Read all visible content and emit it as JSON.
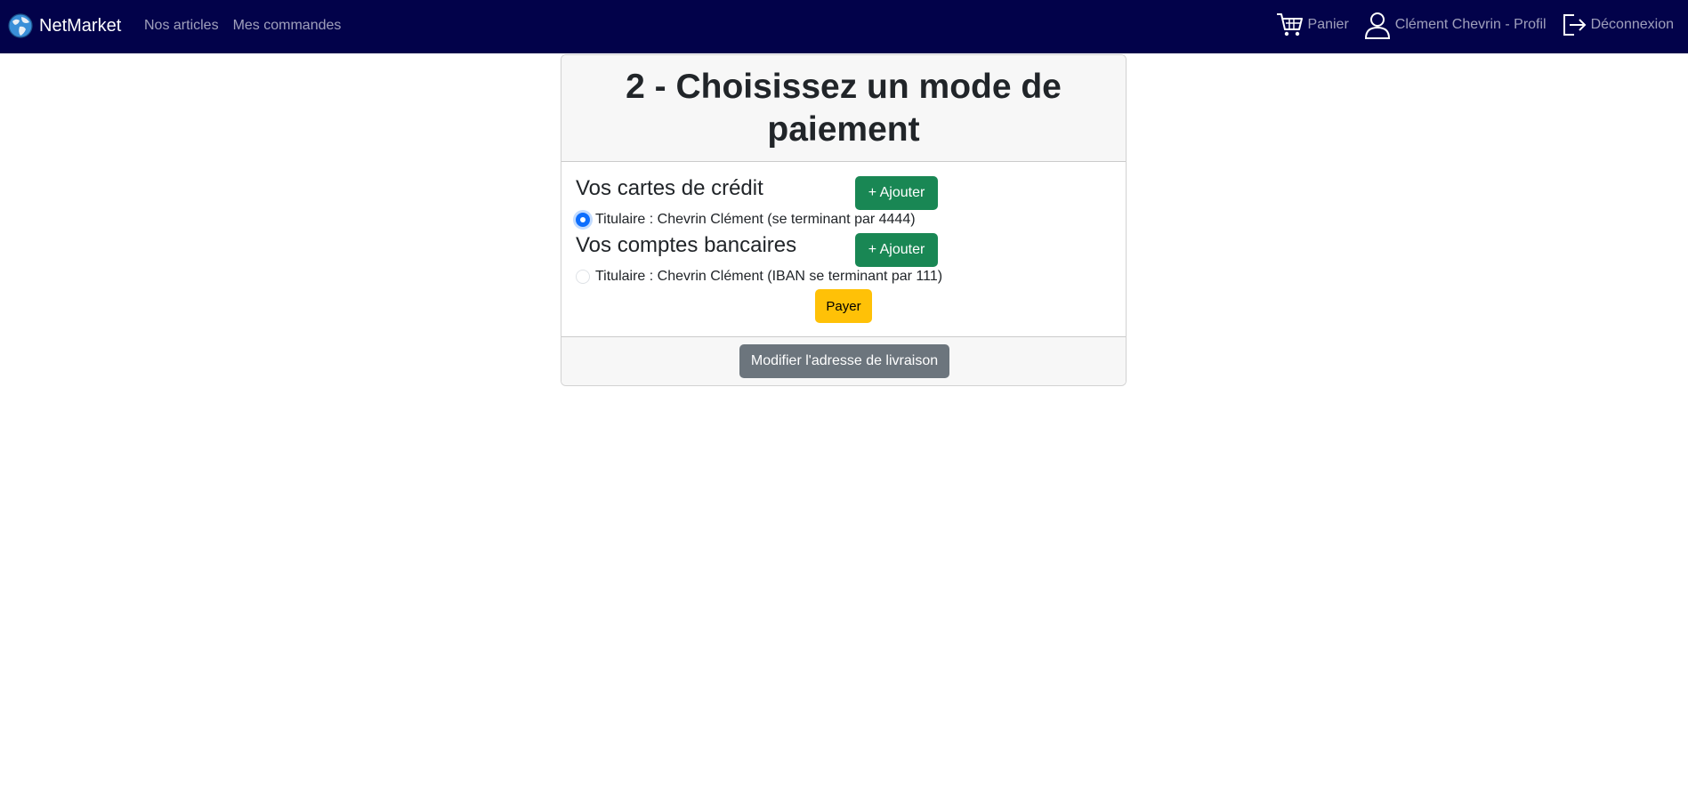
{
  "navbar": {
    "brand": "NetMarket",
    "links": [
      "Nos articles",
      "Mes commandes"
    ],
    "cart_label": "Panier",
    "profile_label": "Clément Chevrin - Profil",
    "logout_label": "Déconnexion"
  },
  "card": {
    "title": "2 - Choisissez un mode de paiement",
    "credit_cards": {
      "heading": "Vos cartes de crédit",
      "add_label": "+ Ajouter",
      "items": [
        {
          "label": "Titulaire : Chevrin Clément (se terminant par 4444)",
          "checked": true
        }
      ]
    },
    "bank_accounts": {
      "heading": "Vos comptes bancaires",
      "add_label": "+ Ajouter",
      "items": [
        {
          "label": "Titulaire : Chevrin Clément (IBAN se terminant par 111)",
          "checked": false
        }
      ]
    },
    "pay_label": "Payer",
    "footer_button_label": "Modifier l'adresse de livraison"
  },
  "colors": {
    "navbar_bg": "#02024a",
    "success": "#198754",
    "warning": "#ffc107",
    "secondary": "#6c757d",
    "primary": "#0d6efd"
  }
}
